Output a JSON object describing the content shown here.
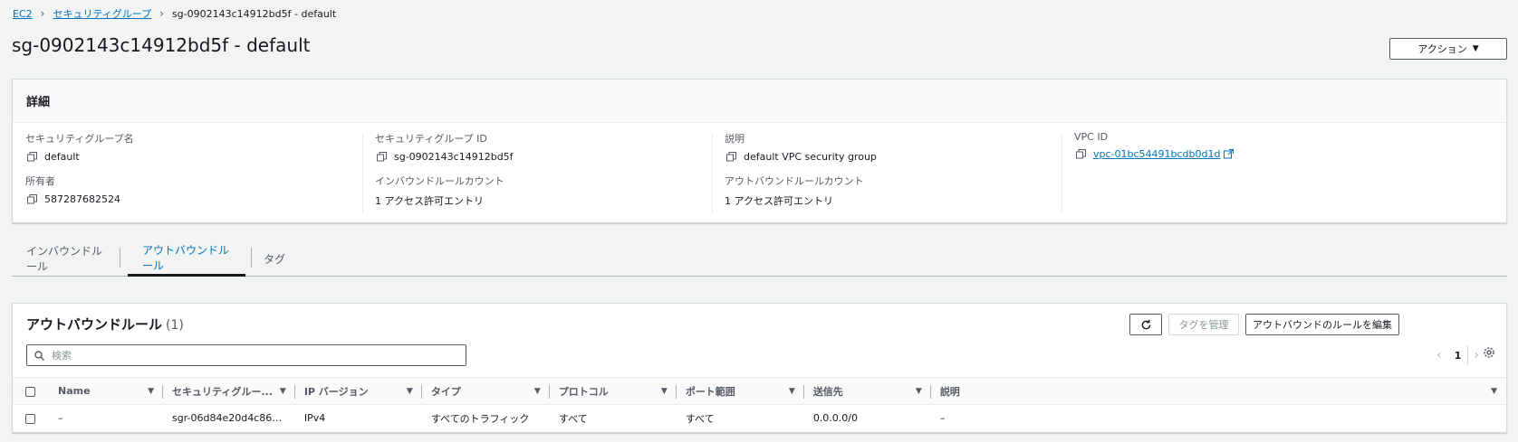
{
  "breadcrumb": {
    "root": "EC2",
    "parent": "セキュリティグループ",
    "current": "sg-0902143c14912bd5f - default"
  },
  "page": {
    "title": "sg-0902143c14912bd5f - default",
    "actions_label": "アクション"
  },
  "details": {
    "header": "詳細",
    "sg_name_label": "セキュリティグループ名",
    "sg_name": "default",
    "sg_id_label": "セキュリティグループ ID",
    "sg_id": "sg-0902143c14912bd5f",
    "desc_label": "説明",
    "desc": "default VPC security group",
    "vpc_label": "VPC ID",
    "vpc": "vpc-01bc54491bcdb0d1d",
    "owner_label": "所有者",
    "owner": "587287682524",
    "inbound_count_label": "インバウンドルールカウント",
    "inbound_count": "1 アクセス許可エントリ",
    "outbound_count_label": "アウトバウンドルールカウント",
    "outbound_count": "1 アクセス許可エントリ"
  },
  "tabs": [
    "インバウンドルール",
    "アウトバウンドルール",
    "タグ"
  ],
  "rules": {
    "title": "アウトバウンドルール",
    "count": "(1)",
    "manage_tags": "タグを管理",
    "edit_rules": "アウトバウンドのルールを編集",
    "search_placeholder": "検索",
    "page": "1",
    "columns": [
      "Name",
      "セキュリティグルー...",
      "IP バージョン",
      "タイプ",
      "プロトコル",
      "ポート範囲",
      "送信先",
      "説明"
    ],
    "rows": [
      [
        "–",
        "sgr-06d84e20d4c86dc...",
        "IPv4",
        "すべてのトラフィック",
        "すべて",
        "すべて",
        "0.0.0.0/0",
        "–"
      ]
    ]
  },
  "colors": {
    "link": "#0073bb",
    "text": "#16191f",
    "muted": "#545b64",
    "background": "#f2f3f3"
  }
}
